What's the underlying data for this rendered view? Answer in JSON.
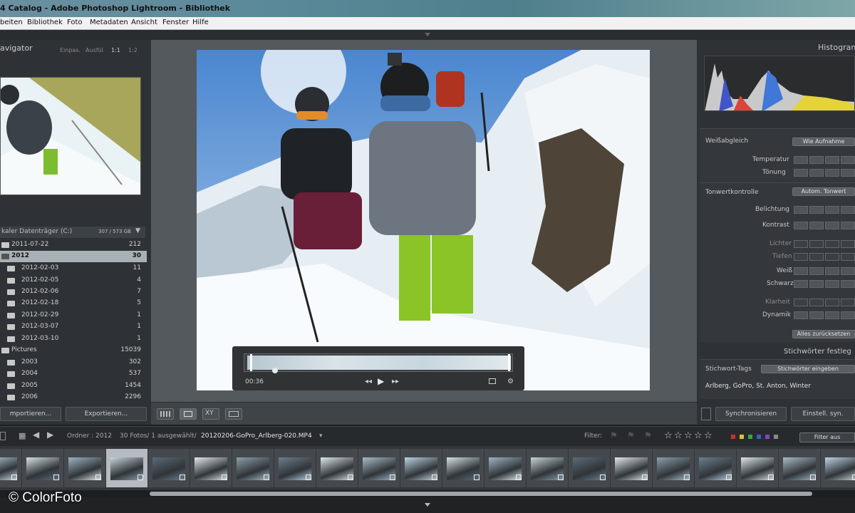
{
  "window": {
    "title": "4 Catalog - Adobe Photoshop Lightroom - Bibliothek"
  },
  "menu": [
    "beiten",
    "Bibliothek",
    "Foto",
    "Metadaten",
    "Ansicht",
    "Fenster",
    "Hilfe"
  ],
  "navigator": {
    "title": "avigator",
    "options": [
      "Einpas.",
      "Ausfül",
      "1:1",
      "1:2"
    ]
  },
  "folders": {
    "volume": "kaler Datenträger (C:)",
    "volume_size": "307 / 573 GB",
    "rows": [
      {
        "name": "2011-07-22",
        "count": "212"
      },
      {
        "name": "2012",
        "count": "30",
        "selected": true
      },
      {
        "name": "2012-02-03",
        "count": "11"
      },
      {
        "name": "2012-02-05",
        "count": "4"
      },
      {
        "name": "2012-02-06",
        "count": "7"
      },
      {
        "name": "2012-02-18",
        "count": "5"
      },
      {
        "name": "2012-02-29",
        "count": "1"
      },
      {
        "name": "2012-03-07",
        "count": "1"
      },
      {
        "name": "2012-03-10",
        "count": "1"
      },
      {
        "name": "Pictures",
        "count": "15039"
      },
      {
        "name": "2003",
        "count": "302"
      },
      {
        "name": "2004",
        "count": "537"
      },
      {
        "name": "2005",
        "count": "1454"
      },
      {
        "name": "2006",
        "count": "2296"
      }
    ]
  },
  "left_buttons": {
    "import": "mportieren...",
    "export": "Exportieren..."
  },
  "video": {
    "time": "00:36"
  },
  "histogram": {
    "title": "Histogram"
  },
  "quick_develop": {
    "white_balance_label": "Weißabgleich",
    "white_balance_value": "Wie Aufnahme",
    "temperature": "Temperatur",
    "tint": "Tönung",
    "tone_control": "Tonwertkontrolle",
    "auto_tone": "Autom. Tonwert",
    "exposure": "Belichtung",
    "contrast": "Kontrast",
    "highlights": "Lichter",
    "shadows": "Tiefen",
    "whites": "Weiß",
    "blacks": "Schwarz",
    "clarity": "Klarheit",
    "vibrance": "Dynamik",
    "reset_all": "Alles zurücksetzen"
  },
  "keywords": {
    "title": "Stichwörter festleg",
    "tags_label": "Stichwort-Tags",
    "tags_mode": "Stichwörter eingeben",
    "tags_value": "Arlberg, GoPro, St. Anton, Winter"
  },
  "right_buttons": {
    "sync": "Synchronisieren",
    "sync_settings": "Einstell. syn."
  },
  "filterbar": {
    "folder": "Ordner : 2012",
    "count": "30 Fotos/ 1 ausgewählt/",
    "filename": "20120206-GoPro_Arlberg-020.MP4",
    "filter_label": "Filter:",
    "filter_value": "Filter aus"
  },
  "copyright": "© ColorFoto",
  "colors": {
    "panel": "#2e3236",
    "center": "#54595e",
    "selected": "#a9b0b6"
  }
}
